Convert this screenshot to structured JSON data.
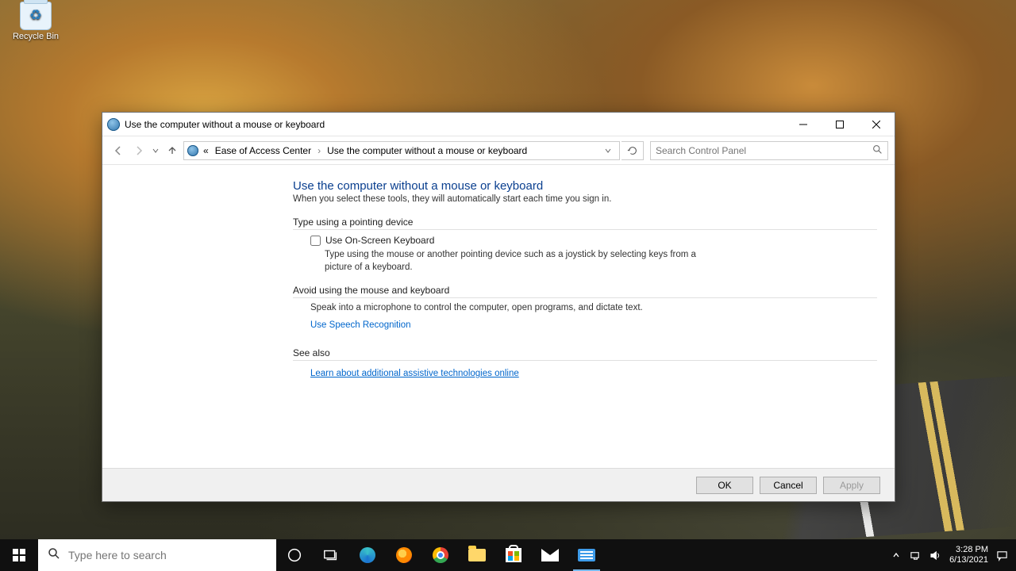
{
  "desktop": {
    "recycle_bin_label": "Recycle Bin"
  },
  "window": {
    "title": "Use the computer without a mouse or keyboard",
    "breadcrumbs": {
      "prefix": "«",
      "level1": "Ease of Access Center",
      "level2": "Use the computer without a mouse or keyboard"
    },
    "search_placeholder": "Search Control Panel",
    "content": {
      "heading": "Use the computer without a mouse or keyboard",
      "subtitle": "When you select these tools, they will automatically start each time you sign in.",
      "section1_head": "Type using a pointing device",
      "checkbox1_label": "Use On-Screen Keyboard",
      "checkbox1_checked": false,
      "checkbox1_desc": "Type using the mouse or another pointing device such as a joystick by selecting keys from a picture of a keyboard.",
      "section2_head": "Avoid using the mouse and keyboard",
      "section2_body": "Speak into a microphone to control the computer, open programs, and dictate text.",
      "section2_link": "Use Speech Recognition",
      "section3_head": "See also",
      "section3_link": "Learn about additional assistive technologies online"
    },
    "buttons": {
      "ok": "OK",
      "cancel": "Cancel",
      "apply": "Apply"
    }
  },
  "taskbar": {
    "search_placeholder": "Type here to search",
    "clock_time": "3:28 PM",
    "clock_date": "6/13/2021"
  }
}
